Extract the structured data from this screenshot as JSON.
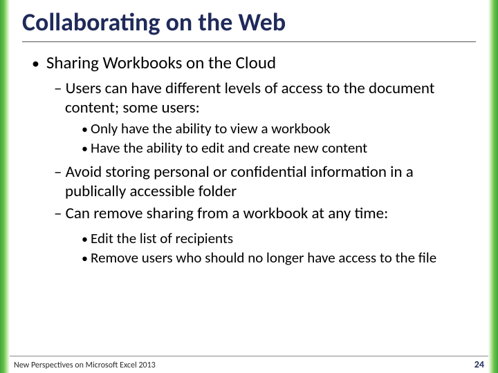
{
  "title": "Collaborating on the Web",
  "b1": "Sharing Workbooks on the Cloud",
  "b1_1": "Users can have different levels of access to the document content; some users:",
  "b1_1_a": "Only have the ability to view a workbook",
  "b1_1_b": "Have the ability to edit and create new content",
  "b1_2": "Avoid storing personal or confidential information in a publically accessible folder",
  "b1_3": "Can remove sharing from a workbook at any time:",
  "b1_3_a": "Edit the list of recipients",
  "b1_3_b": "Remove users who should no longer have access to the file",
  "footer_text": "New Perspectives on Microsoft Excel 2013",
  "page_number": "24"
}
